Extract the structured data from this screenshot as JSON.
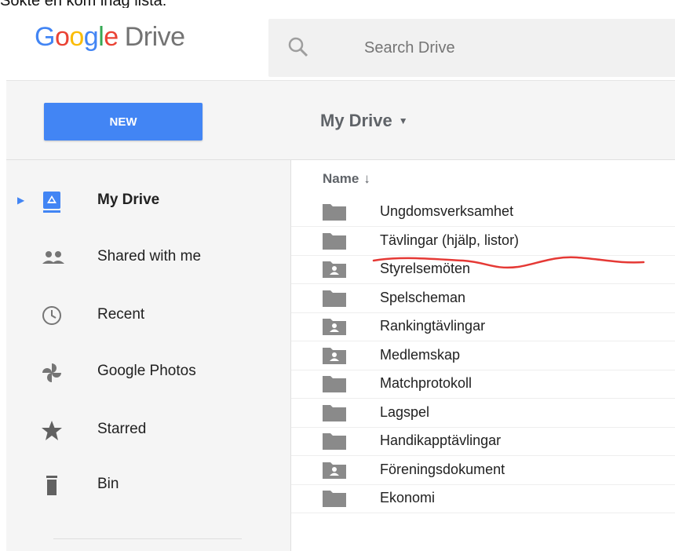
{
  "caption": "Sökte en kom ihåg lista:",
  "header": {
    "logo_google": "Google",
    "logo_drive": "Drive",
    "search_placeholder": "Search Drive"
  },
  "toolbar": {
    "new_label": "NEW",
    "breadcrumb": "My Drive"
  },
  "sidebar": {
    "items": [
      {
        "label": "My Drive",
        "icon": "my-drive-icon"
      },
      {
        "label": "Shared with me",
        "icon": "shared-people-icon"
      },
      {
        "label": "Recent",
        "icon": "clock-icon"
      },
      {
        "label": "Google Photos",
        "icon": "photos-pinwheel-icon"
      },
      {
        "label": "Starred",
        "icon": "star-icon"
      },
      {
        "label": "Bin",
        "icon": "trash-icon"
      }
    ]
  },
  "filelist": {
    "column_name": "Name",
    "sort_arrow": "↓",
    "rows": [
      {
        "name": "Ungdomsverksamhet",
        "icon": "folder-icon"
      },
      {
        "name": "Tävlingar (hjälp, listor)",
        "icon": "folder-icon"
      },
      {
        "name": "Styrelsemöten",
        "icon": "shared-folder-icon"
      },
      {
        "name": "Spelscheman",
        "icon": "folder-icon"
      },
      {
        "name": "Rankingtävlingar",
        "icon": "shared-folder-icon"
      },
      {
        "name": "Medlemskap",
        "icon": "shared-folder-icon"
      },
      {
        "name": "Matchprotokoll",
        "icon": "folder-icon"
      },
      {
        "name": "Lagspel",
        "icon": "folder-icon"
      },
      {
        "name": "Handikapptävlingar",
        "icon": "folder-icon"
      },
      {
        "name": "Föreningsdokument",
        "icon": "shared-folder-icon"
      },
      {
        "name": "Ekonomi",
        "icon": "folder-icon"
      }
    ]
  },
  "colors": {
    "accent": "#4285F4",
    "folder": "#8a8a8a",
    "annotation": "#e53935"
  }
}
